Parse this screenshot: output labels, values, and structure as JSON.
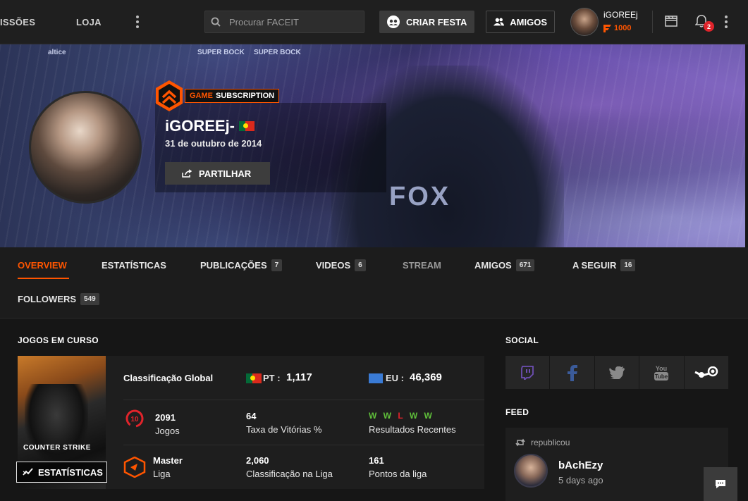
{
  "topbar": {
    "nav": [
      "ISSÕES",
      "LOJA"
    ],
    "search_placeholder": "Procurar FACEIT",
    "party_label": "CRIAR FESTA",
    "friends_label": "AMIGOS",
    "username": "iGOREEj",
    "points": "1000",
    "notifications": "2"
  },
  "banner": {
    "ads": [
      "altice",
      "SUPER BOCK",
      "SUPER BOCK"
    ],
    "jersey_text": "FOX",
    "subscription_prefix": "GAME",
    "subscription_label": "SUBSCRIPTION",
    "name": "iGOREEj-",
    "date": "31 de outubro de 2014",
    "share_label": "PARTILHAR"
  },
  "tabs": [
    {
      "label": "OVERVIEW",
      "count": ""
    },
    {
      "label": "ESTATÍSTICAS",
      "count": ""
    },
    {
      "label": "PUBLICAÇÕES",
      "count": "7"
    },
    {
      "label": "VIDEOS",
      "count": "6"
    },
    {
      "label": "STREAM",
      "count": ""
    },
    {
      "label": "AMIGOS",
      "count": "671"
    },
    {
      "label": "A SEGUIR",
      "count": "16"
    },
    {
      "label": "FOLLOWERS",
      "count": "549"
    }
  ],
  "games": {
    "title": "JOGOS EM CURSO",
    "cover_title": "COUNTER STRIKE",
    "stats_button": "ESTATÍSTICAS",
    "global_rank_label": "Classificação Global",
    "pt_label": "PT :",
    "pt_value": "1,117",
    "eu_label": "EU :",
    "eu_value": "46,369",
    "level": "10",
    "matches_value": "2091",
    "matches_label": "Jogos",
    "winrate_value": "64",
    "winrate_label": "Taxa de Vitórias %",
    "recent_results": [
      "W",
      "W",
      "L",
      "W",
      "W"
    ],
    "recent_label": "Resultados Recentes",
    "league_value": "Master",
    "league_label": "Liga",
    "league_rank_value": "2,060",
    "league_rank_label": "Classificação na Liga",
    "league_points_value": "161",
    "league_points_label": "Pontos da liga"
  },
  "social": {
    "title": "SOCIAL",
    "icons": [
      "twitch-icon",
      "facebook-icon",
      "twitter-icon",
      "youtube-icon",
      "steam-icon"
    ]
  },
  "feed": {
    "title": "FEED",
    "repost_label": "republicou",
    "author": "bAchEzy",
    "time": "5 days ago"
  },
  "colors": {
    "accent": "#ff5500",
    "win": "#5fbf3a",
    "loss": "#e0242b"
  }
}
